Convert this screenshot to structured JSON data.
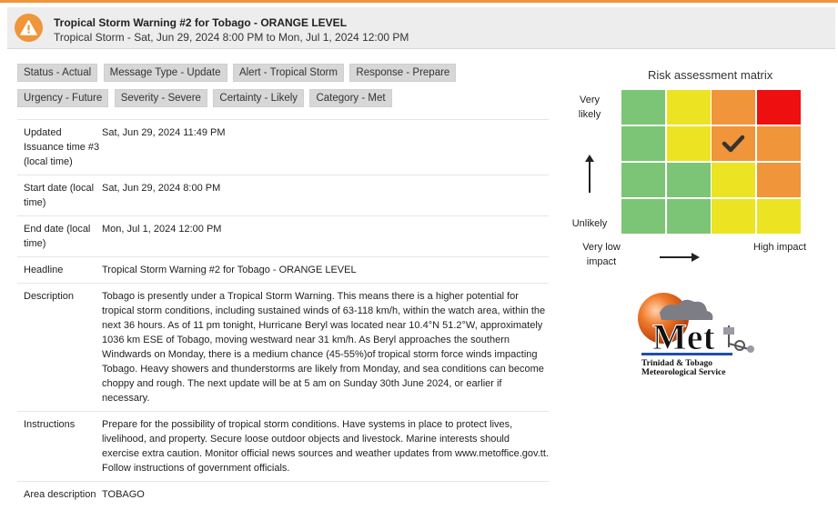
{
  "header": {
    "title": "Tropical Storm Warning #2 for Tobago - ORANGE LEVEL",
    "subtitle": "Tropical Storm - Sat, Jun 29, 2024 8:00 PM to Mon, Jul 1, 2024 12:00 PM",
    "icon": "warning-icon",
    "accent_color": "#f0953a"
  },
  "tags": [
    "Status - Actual",
    "Message Type - Update",
    "Alert - Tropical Storm",
    "Response - Prepare",
    "Urgency - Future",
    "Severity - Severe",
    "Certainty - Likely",
    "Category - Met"
  ],
  "details": [
    {
      "label": "Updated Issuance time #3 (local time)",
      "value": "Sat, Jun 29, 2024 11:49 PM"
    },
    {
      "label": "Start date (local time)",
      "value": "Sat, Jun 29, 2024 8:00 PM"
    },
    {
      "label": "End date (local time)",
      "value": "Mon, Jul 1, 2024 12:00 PM"
    },
    {
      "label": "Headline",
      "value": "Tropical Storm Warning #2 for Tobago - ORANGE LEVEL"
    },
    {
      "label": "Description",
      "value": "Tobago is presently under a Tropical Storm Warning. This means there is a higher potential for tropical storm conditions, including sustained winds of 63-118 km/h, within the watch area, within the next 36 hours. As of 11 pm tonight, Hurricane Beryl was located near 10.4°N 51.2°W, approximately 1036 km ESE of Tobago, moving westward near 31 km/h. As Beryl approaches the southern Windwards on Monday, there is a medium chance (45-55%)of tropical storm force winds impacting Tobago. Heavy showers and thunderstorms are likely from Monday, and sea conditions can become choppy and rough. The next update will be at 5 am on Sunday 30th June 2024, or earlier if necessary."
    },
    {
      "label": "Instructions",
      "value": "Prepare for the possibility of tropical storm conditions. Have systems in place to protect lives, livelihood, and property. Secure loose outdoor objects and livestock. Marine interests should exercise extra caution. Monitor official news sources and weather updates from www.metoffice.gov.tt. Follow instructions of government officials."
    },
    {
      "label": "Area description",
      "value": "TOBAGO"
    }
  ],
  "risk_matrix": {
    "title": "Risk assessment matrix",
    "y_top_label": "Very likely",
    "y_bottom_label": "Unlikely",
    "x_left_label": "Very low impact",
    "x_right_label": "High impact",
    "rows": [
      [
        "green",
        "yellow",
        "orange",
        "red"
      ],
      [
        "green",
        "yellow",
        "orange",
        "orange"
      ],
      [
        "green",
        "green",
        "yellow",
        "orange"
      ],
      [
        "green",
        "green",
        "yellow",
        "yellow"
      ]
    ],
    "selected": {
      "row": 1,
      "col": 2
    },
    "colors": {
      "green": "#7cc576",
      "yellow": "#ece423",
      "orange": "#f0953a",
      "red": "#ee1010"
    }
  },
  "logo": {
    "main_text": "Met",
    "line1": "Trinidad & Tobago",
    "line2": "Meteorological Service"
  }
}
